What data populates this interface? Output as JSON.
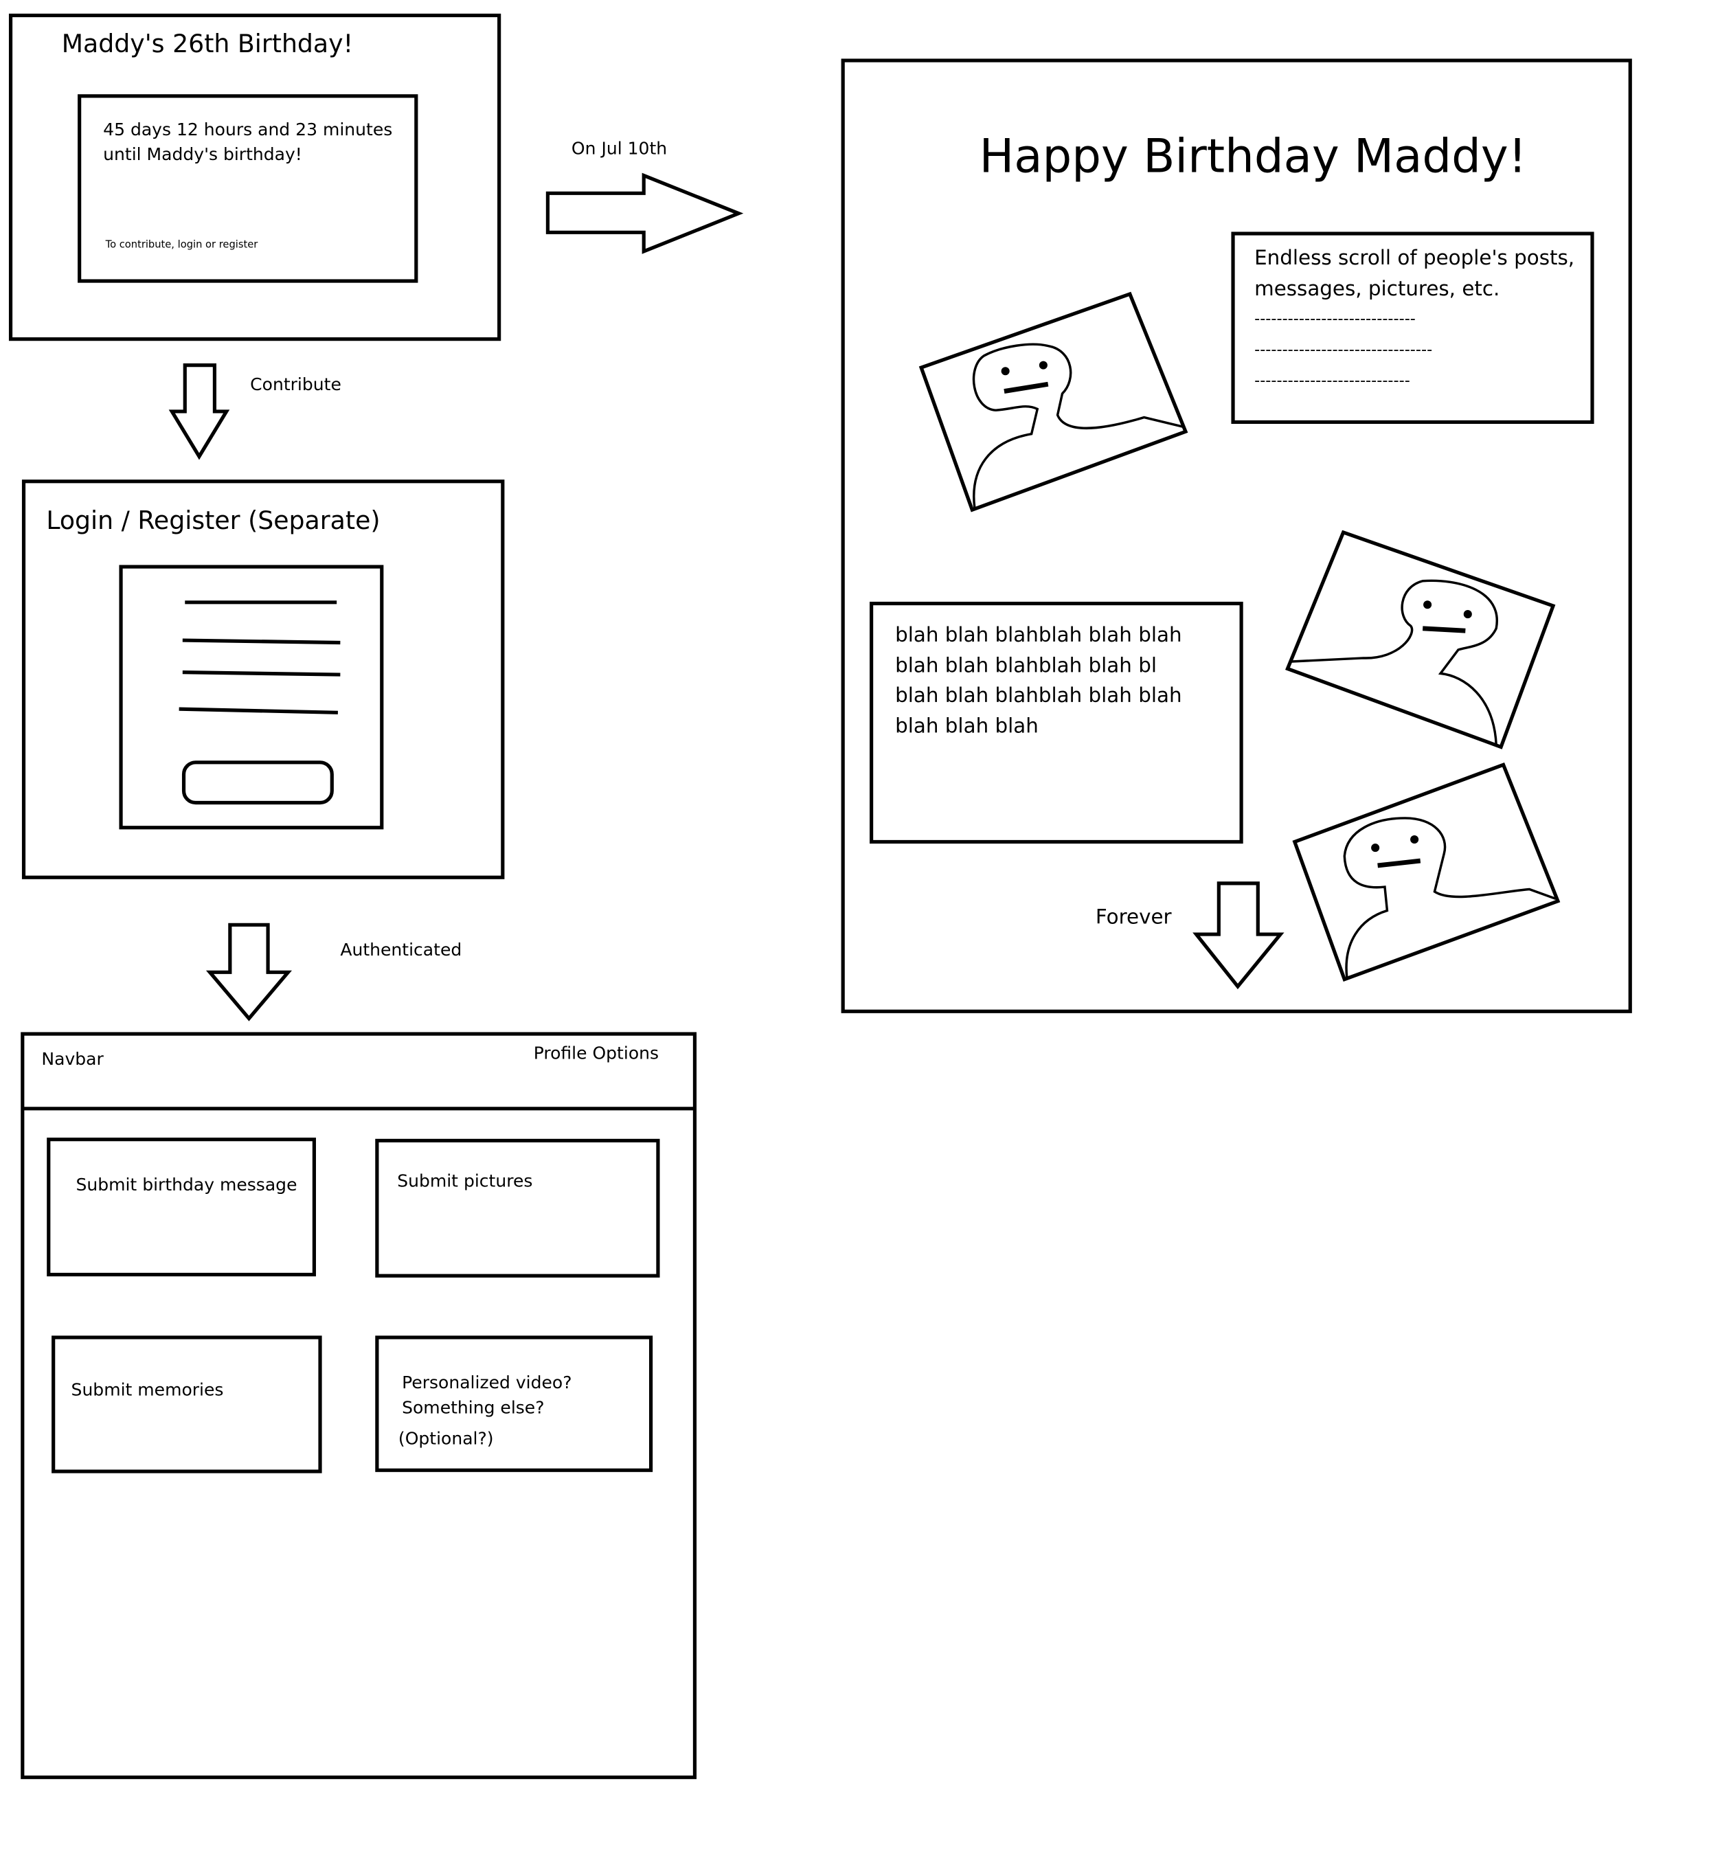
{
  "countdown_page": {
    "title": "Maddy's 26th Birthday!",
    "countdown_text": "45 days 12 hours and 23 minutes\nuntil Maddy's birthday!",
    "contribute_hint": "To contribute, login or register"
  },
  "arrows": {
    "date_transition": "On Jul 10th",
    "contribute": "Contribute",
    "authenticated": "Authenticated",
    "forever": "Forever"
  },
  "login_page": {
    "title": "Login / Register (Separate)"
  },
  "dashboard": {
    "navbar_label": "Navbar",
    "profile_options": "Profile Options",
    "cards": [
      {
        "label": "Submit birthday message"
      },
      {
        "label": "Submit pictures"
      },
      {
        "label": "Submit memories"
      },
      {
        "label": "Personalized video?\nSomething else?"
      }
    ],
    "optional_note": "(Optional?)"
  },
  "birthday_page": {
    "title": "Happy Birthday Maddy!",
    "feed_text": "Endless scroll of people's posts,\nmessages, pictures, etc.",
    "feed_dashes": [
      "-----------------------------",
      "--------------------------------",
      "----------------------------"
    ],
    "blah_text": "blah blah blahblah blah blah\nblah blah blahblah blah bl\nblah blah blahblah blah blah\nblah blah blah"
  }
}
